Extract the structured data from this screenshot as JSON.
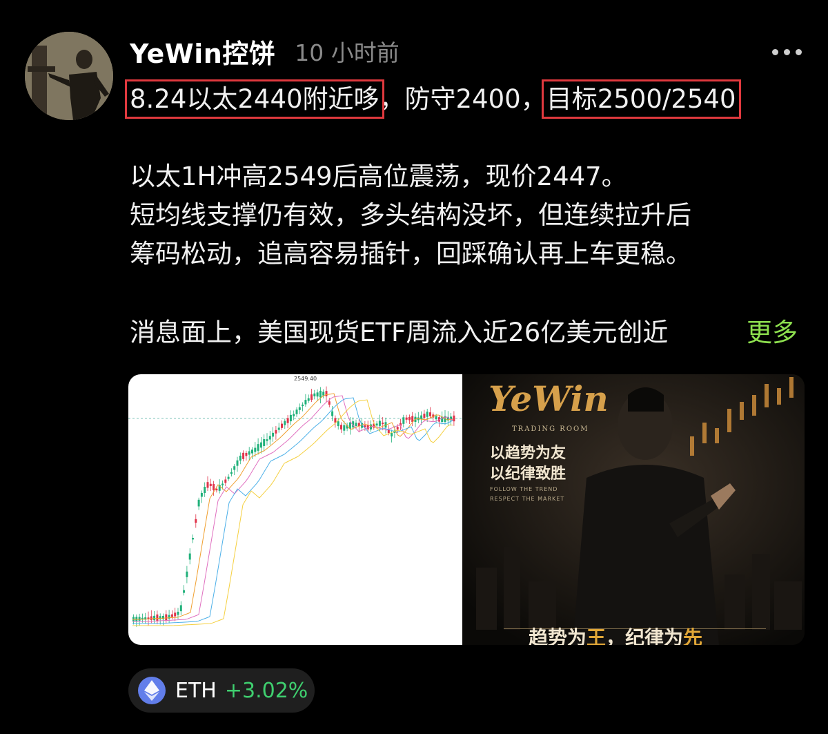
{
  "post": {
    "author": "YeWin控饼",
    "time": "10 小时前",
    "line1": {
      "entry": "8.24以太2440附近哆",
      "sep1": "，防守2400，",
      "target": "目标2500/2540"
    },
    "body": [
      "以太1H冲高2549后高位震荡，现价2447。",
      "短均线支撑仍有效，多头结构没坏，但连续拉升后",
      "筹码松动，追高容易插针，回踩确认再上车更稳。"
    ],
    "news_line": "消息面上，美国现货ETF周流入近26亿美元创近",
    "more_label": "更多"
  },
  "chart_image": {
    "peak_label": "2549.40"
  },
  "promo_image": {
    "brand": "YeWin",
    "subtitle": "TRADING ROOM",
    "slogan1": "以趋势为友",
    "slogan2": "以纪律致胜",
    "en1": "FOLLOW THE TREND",
    "en2": "RESPECT THE MARKET",
    "bottom_a": "趋势为",
    "bottom_b": "王",
    "bottom_c": "，纪律为",
    "bottom_d": "先"
  },
  "ticker": {
    "symbol": "ETH",
    "change": "+3.02%"
  },
  "colors": {
    "highlight_box": "#e0393e",
    "link_green": "#8ee04f",
    "change_green": "#3fcf6f",
    "eth_blue": "#627eea"
  }
}
